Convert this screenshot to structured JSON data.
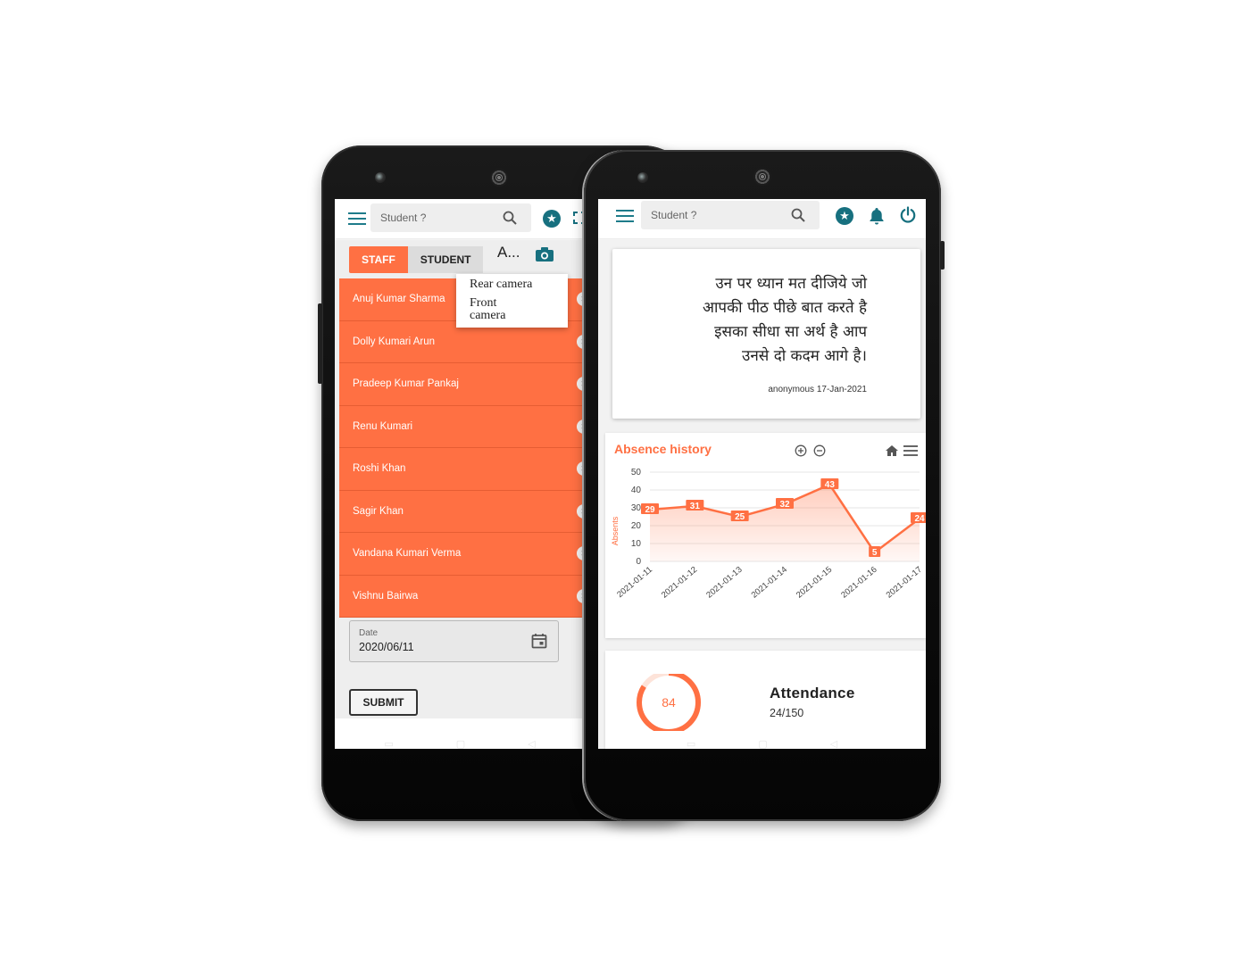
{
  "left_phone": {
    "search": {
      "placeholder": "Student ?"
    },
    "tabs": {
      "staff": "STAFF",
      "student": "STUDENT",
      "overflow": "A..."
    },
    "camera_menu": {
      "rear": "Rear camera",
      "front": "Front camera"
    },
    "list_items": [
      "Anuj Kumar Sharma",
      "Dolly Kumari Arun",
      "Pradeep Kumar Pankaj",
      "Renu Kumari",
      "Roshi Khan",
      "Sagir Khan",
      "Vandana Kumari Verma",
      "Vishnu Bairwa"
    ],
    "date": {
      "label": "Date",
      "value": "2020/06/11"
    },
    "submit_label": "SUBMIT"
  },
  "right_phone": {
    "search": {
      "placeholder": "Student ?"
    },
    "quote": {
      "text": "उन पर ध्यान मत दीजिये जो\nआपकी पीठ पीछे बात करते है\nइसका सीधा सा अर्थ है आप\nउनसे दो कदम आगे है।",
      "author_date": "anonymous 17-Jan-2021"
    },
    "attendance": {
      "title": "Attendance",
      "value": "84",
      "ratio": "24/150",
      "ring_fraction": 0.84
    }
  },
  "colors": {
    "accent": "#ff7043",
    "teal": "#17707f",
    "list_bg": "#ff7043"
  },
  "icons": [
    "menu-icon",
    "search-icon",
    "star-icon",
    "fullscreen-icon",
    "camera-icon",
    "close-icon",
    "calendar-icon",
    "bell-icon",
    "power-icon",
    "zoom-in-icon",
    "zoom-out-icon",
    "home-icon"
  ],
  "chart_data": {
    "type": "area",
    "title": "Absence history",
    "ylabel": "Absents",
    "xlabel": "",
    "ylim": [
      0,
      50
    ],
    "yticks": [
      0,
      10,
      20,
      30,
      40,
      50
    ],
    "categories": [
      "2021-01-11",
      "2021-01-12",
      "2021-01-13",
      "2021-01-14",
      "2021-01-15",
      "2021-01-16",
      "2021-01-17"
    ],
    "values": [
      29,
      31,
      25,
      32,
      43,
      5,
      24
    ],
    "grid": true
  }
}
